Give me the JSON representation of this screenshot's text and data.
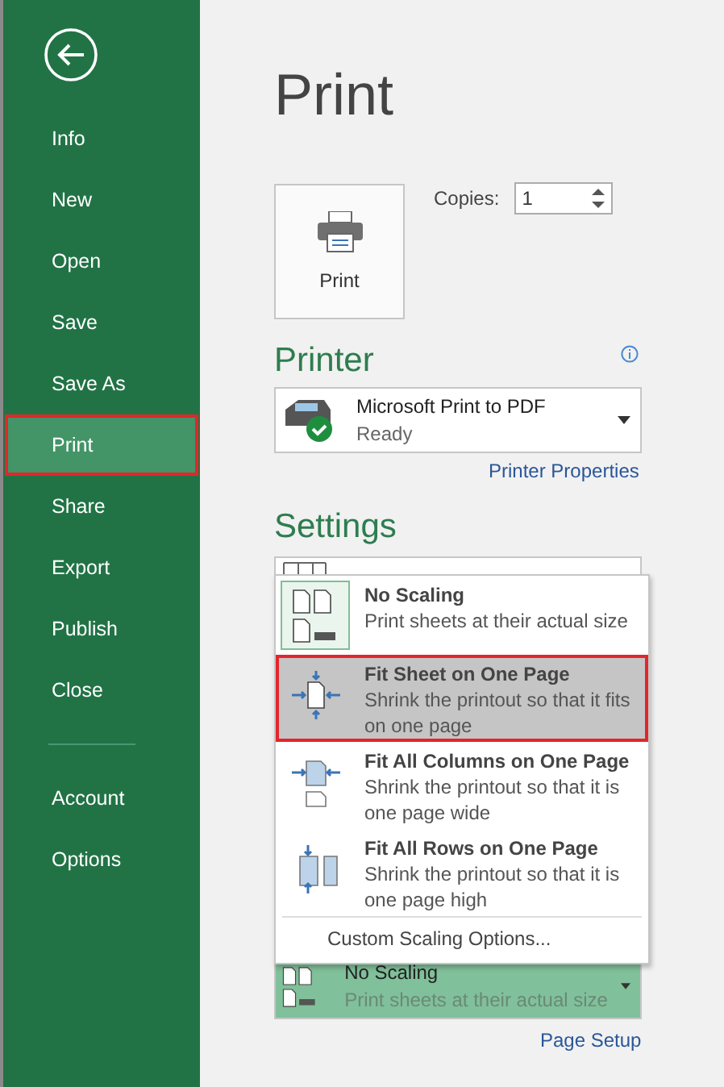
{
  "sidebar": {
    "back_button": true,
    "items": [
      {
        "label": "Info",
        "selected": false,
        "annotated": false
      },
      {
        "label": "New",
        "selected": false,
        "annotated": false
      },
      {
        "label": "Open",
        "selected": false,
        "annotated": false
      },
      {
        "label": "Save",
        "selected": false,
        "annotated": false
      },
      {
        "label": "Save As",
        "selected": false,
        "annotated": false
      },
      {
        "label": "Print",
        "selected": true,
        "annotated": true
      },
      {
        "label": "Share",
        "selected": false,
        "annotated": false
      },
      {
        "label": "Export",
        "selected": false,
        "annotated": false
      },
      {
        "label": "Publish",
        "selected": false,
        "annotated": false
      },
      {
        "label": "Close",
        "selected": false,
        "annotated": false
      }
    ],
    "bottom_items": [
      {
        "label": "Account",
        "selected": false,
        "annotated": false
      },
      {
        "label": "Options",
        "selected": false,
        "annotated": false
      }
    ]
  },
  "title": "Print",
  "print_button": {
    "label": "Print"
  },
  "copies": {
    "label": "Copies:",
    "value": "1"
  },
  "printer": {
    "heading": "Printer",
    "name": "Microsoft Print to PDF",
    "status": "Ready",
    "link": "Printer Properties"
  },
  "settings": {
    "heading": "Settings",
    "scaling_menu": [
      {
        "kind": "none",
        "title": "No Scaling",
        "description": "Print sheets at their actual size",
        "selected": true,
        "hovered": false,
        "annotated": false
      },
      {
        "kind": "sheet",
        "title": "Fit Sheet on One Page",
        "description": "Shrink the printout so that it fits on one page",
        "selected": false,
        "hovered": true,
        "annotated": true
      },
      {
        "kind": "columns",
        "title": "Fit All Columns on One Page",
        "description": "Shrink the printout so that it is one page wide",
        "selected": false,
        "hovered": false,
        "annotated": false
      },
      {
        "kind": "rows",
        "title": "Fit All Rows on One Page",
        "description": "Shrink the printout so that it is one page high",
        "selected": false,
        "hovered": false,
        "annotated": false
      }
    ],
    "custom_option": "Custom Scaling Options...",
    "scaling_dropdown": {
      "title": "No Scaling",
      "description": "Print sheets at their actual size",
      "open": true
    },
    "link": "Page Setup"
  }
}
